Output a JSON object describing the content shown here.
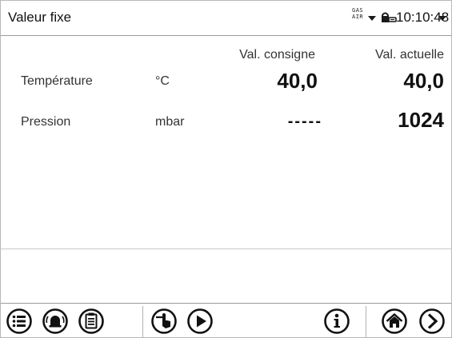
{
  "header": {
    "title": "Valeur fixe",
    "gas_label": "GAS",
    "air_label": "AIR",
    "time": "10:10:48"
  },
  "columns": {
    "setpoint": "Val. consigne",
    "actual": "Val. actuelle"
  },
  "rows": [
    {
      "label": "Température",
      "unit": "°C",
      "setpoint": "40,0",
      "actual": "40,0"
    },
    {
      "label": "Pression",
      "unit": "mbar",
      "setpoint": "-----",
      "actual": "1024"
    }
  ],
  "toolbar": {
    "icons": [
      "menu-icon",
      "alarm-icon",
      "clipboard-icon",
      "touch-icon",
      "play-icon",
      "info-icon",
      "home-icon",
      "next-icon"
    ]
  },
  "colors": {
    "text": "#111111",
    "border": "#9a9a9a"
  }
}
